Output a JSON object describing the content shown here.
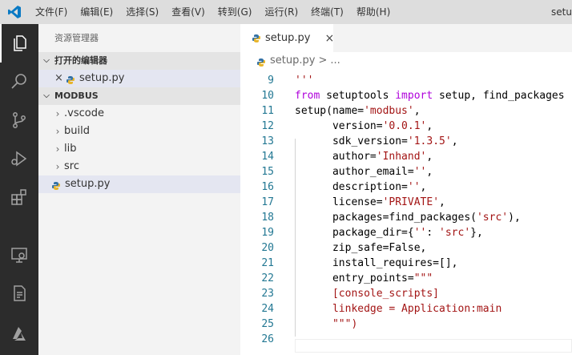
{
  "window": {
    "title": "setu",
    "menu": [
      "文件(F)",
      "编辑(E)",
      "选择(S)",
      "查看(V)",
      "转到(G)",
      "运行(R)",
      "终端(T)",
      "帮助(H)"
    ]
  },
  "activity_bar": {
    "items": [
      "explorer-icon",
      "search-icon",
      "source-control-icon",
      "run-debug-icon",
      "extensions-icon",
      "remote-explorer-icon",
      "notebook-icon",
      "azure-icon"
    ]
  },
  "sidebar": {
    "title": "资源管理器",
    "open_editors": {
      "label": "打开的编辑器",
      "items": [
        {
          "name": "setup.py"
        }
      ]
    },
    "workspace": {
      "label": "MODBUS",
      "items": [
        {
          "name": ".vscode",
          "type": "folder"
        },
        {
          "name": "build",
          "type": "folder"
        },
        {
          "name": "lib",
          "type": "folder"
        },
        {
          "name": "src",
          "type": "folder"
        },
        {
          "name": "setup.py",
          "type": "file"
        }
      ]
    }
  },
  "editor": {
    "tab": {
      "label": "setup.py",
      "close": "×"
    },
    "breadcrumb": {
      "file": "setup.py",
      "separator": ">",
      "rest": "..."
    },
    "lines": [
      {
        "n": "",
        "t": "'''"
      },
      {
        "n": "9",
        "t": "'''"
      },
      {
        "n": "10",
        "t": "from setuptools import setup, find_packages"
      },
      {
        "n": "11",
        "t": "setup(name='modbus',"
      },
      {
        "n": "12",
        "t": "      version='0.0.1',"
      },
      {
        "n": "13",
        "t": "      sdk_version='1.3.5',"
      },
      {
        "n": "14",
        "t": "      author='Inhand',"
      },
      {
        "n": "15",
        "t": "      author_email='',"
      },
      {
        "n": "16",
        "t": "      description='',"
      },
      {
        "n": "17",
        "t": "      license='PRIVATE',"
      },
      {
        "n": "18",
        "t": "      packages=find_packages('src'),"
      },
      {
        "n": "19",
        "t": "      package_dir={'': 'src'},"
      },
      {
        "n": "20",
        "t": "      zip_safe=False,"
      },
      {
        "n": "21",
        "t": "      install_requires=[],"
      },
      {
        "n": "22",
        "t": "      entry_points=\"\"\""
      },
      {
        "n": "23",
        "t": "      [console_scripts]"
      },
      {
        "n": "24",
        "t": "      linkedge = Application:main"
      },
      {
        "n": "25",
        "t": "      \"\"\")"
      },
      {
        "n": "26",
        "t": ""
      }
    ]
  },
  "colors": {
    "keyword": "#af00db",
    "string": "#a31515",
    "line_number": "#237893",
    "activity_bar": "#2c2c2c",
    "titlebar": "#dddddd",
    "sidebar": "#f3f3f3"
  }
}
